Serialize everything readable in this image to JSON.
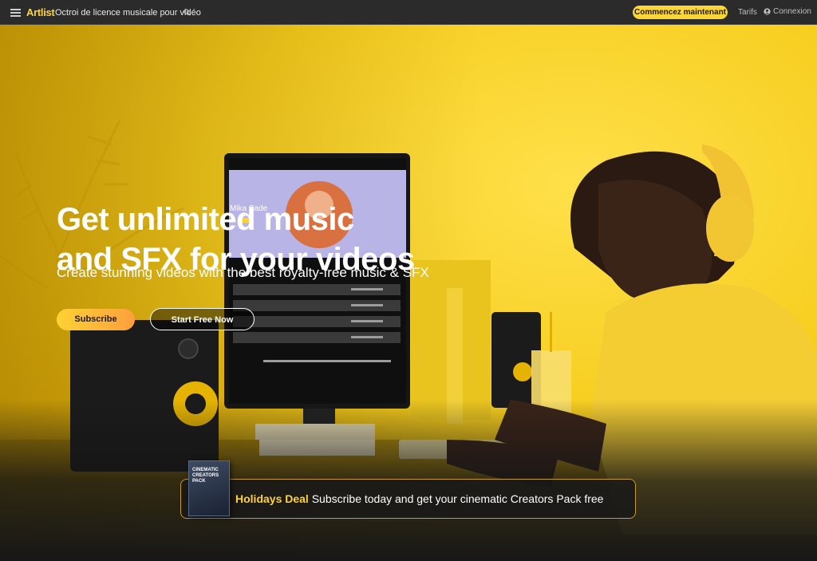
{
  "nav": {
    "logo": "Artlist",
    "product_title": "Octroi de licence musicale pour vidéo",
    "cta_label": "Commencez maintenant",
    "pricing_label": "Tarifs",
    "login_label": "Connexion"
  },
  "hero": {
    "headline_line1": "Get unlimited music",
    "headline_line2": "and SFX for your videos",
    "subheadline": "Create stunning videos with the best royalty-free music & SFX",
    "subscribe_label": "Subscribe",
    "start_free_label": "Start Free Now",
    "screen_artist": "Mika Sade"
  },
  "promo": {
    "box_title": "CINEMATIC CREATORS PACK",
    "highlight": "Holidays Deal",
    "text": "Subscribe today and get your cinematic Creators Pack free"
  },
  "colors": {
    "accent": "#ffd633",
    "topbar": "#2b2b2b",
    "hero_yellow": "#f6cd1d",
    "subscribe_gradient_end": "#ff9f3d"
  },
  "icons": {
    "menu": "hamburger-icon",
    "search": "search-icon",
    "user": "user-circle-icon"
  }
}
